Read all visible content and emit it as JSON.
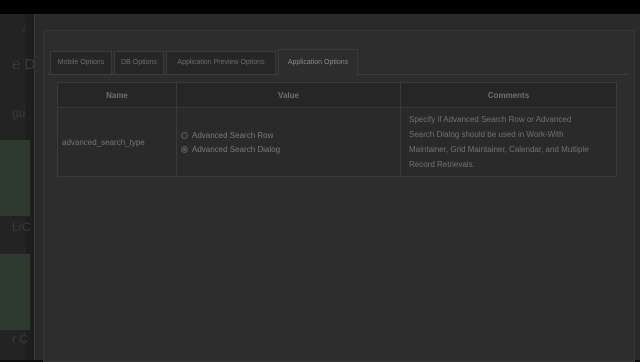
{
  "background": {
    "fragments": [
      "e D",
      "gu",
      "L/C",
      "r C"
    ]
  },
  "tabs": [
    {
      "label": "Mobile Options",
      "active": false
    },
    {
      "label": "DB Options",
      "active": false
    },
    {
      "label": "Application Preview Options",
      "active": false
    },
    {
      "label": "Application Options",
      "active": true
    }
  ],
  "table": {
    "headers": {
      "name": "Name",
      "value": "Value",
      "comments": "Comments"
    },
    "rows": [
      {
        "name": "advanced_search_type",
        "options": [
          {
            "label": "Advanced Search Row",
            "selected": false
          },
          {
            "label": "Advanced Search Dialog",
            "selected": true
          }
        ],
        "comments_lines": [
          "Specify if Advanced Search Row or Advanced",
          "Search Dialog should be used in Work-With",
          "Maintainer, Grid Maintainer, Calendar, and Multiple",
          "Record Retrievals."
        ]
      }
    ]
  }
}
